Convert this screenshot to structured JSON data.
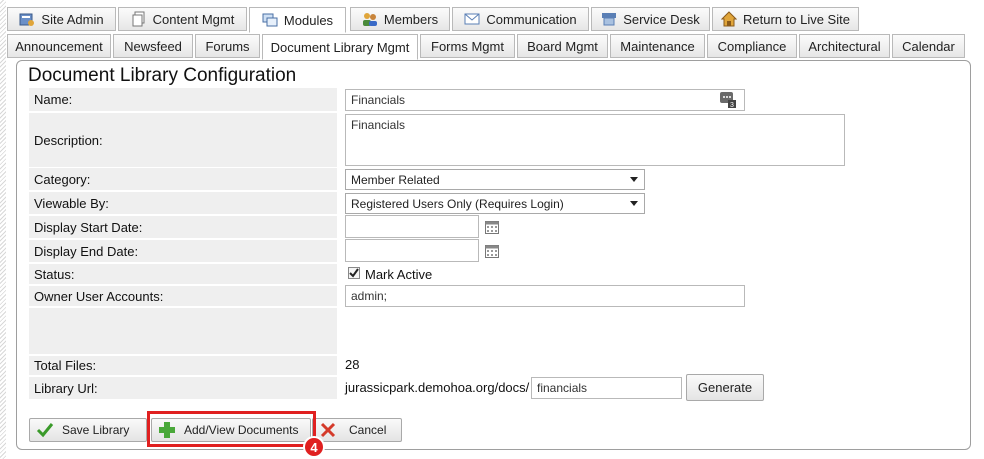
{
  "main_tabs": [
    {
      "label": "Site Admin",
      "icon": "settings-admin-icon"
    },
    {
      "label": "Content Mgmt",
      "icon": "pages-icon"
    },
    {
      "label": "Modules",
      "icon": "modules-icon"
    },
    {
      "label": "Members",
      "icon": "members-icon"
    },
    {
      "label": "Communication",
      "icon": "envelope-icon"
    },
    {
      "label": "Service Desk",
      "icon": "service-desk-icon"
    },
    {
      "label": "Return to Live Site",
      "icon": "home-icon"
    }
  ],
  "active_main_tab": "Modules",
  "sub_tabs": [
    "Announcement",
    "Newsfeed",
    "Forums",
    "Document Library Mgmt",
    "Forms Mgmt",
    "Board Mgmt",
    "Maintenance",
    "Compliance",
    "Architectural",
    "Calendar"
  ],
  "active_sub_tab": "Document Library Mgmt",
  "form": {
    "title": "Document Library Configuration",
    "name_label": "Name:",
    "name_value": "Financials",
    "description_label": "Description:",
    "description_value": "Financials",
    "category_label": "Category:",
    "category_value": "Member Related",
    "viewable_label": "Viewable By:",
    "viewable_value": "Registered Users Only (Requires Login)",
    "start_date_label": "Display Start Date:",
    "start_date_value": "",
    "end_date_label": "Display End Date:",
    "end_date_value": "",
    "status_label": "Status:",
    "status_checkbox_label": "Mark Active",
    "status_checked": true,
    "owner_label": "Owner User Accounts:",
    "owner_value": "admin;",
    "total_files_label": "Total Files:",
    "total_files_value": "28",
    "library_url_label": "Library Url:",
    "library_url_prefix": "jurassicpark.demohoa.org/docs/",
    "library_url_slug": "financials",
    "generate_label": "Generate"
  },
  "actions": {
    "save_label": "Save Library",
    "add_view_label": "Add/View Documents",
    "cancel_label": "Cancel"
  },
  "annotation": {
    "step_number": "4",
    "color": "#e02020"
  }
}
